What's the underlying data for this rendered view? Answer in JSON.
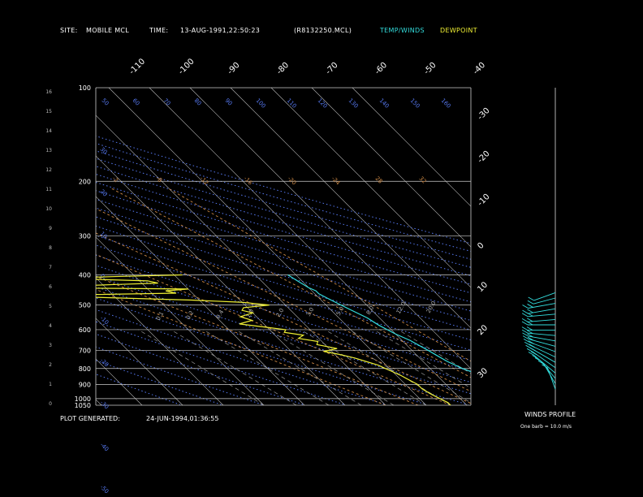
{
  "header": {
    "site_label": "SITE:",
    "site_value": "MOBILE MCL",
    "time_label": "TIME:",
    "time_value": "13-AUG-1991,22:50:23",
    "file": "(R8132250.MCL)",
    "legend_temp": "TEMP/WINDS",
    "legend_dew": "DEWPOINT"
  },
  "footer": {
    "generated_label": "PLOT GENERATED:",
    "generated_value": "24-JUN-1994,01:36:55",
    "winds_title": "WINDS PROFILE",
    "winds_note": "One barb = 10.0 m/s"
  },
  "colors": {
    "temp": "#33dddd",
    "dew": "#eeee33",
    "isotherm": "#bbbbbb",
    "dry_adiabat": "#5577ee",
    "moist_adiabat": "#cc8844",
    "mixing_ratio": "#999999",
    "frame": "#cccccc"
  },
  "chart_data": {
    "type": "line",
    "xlabel": "",
    "ylabel": "",
    "pressure_levels": [
      100,
      200,
      300,
      400,
      500,
      600,
      700,
      800,
      900,
      1000,
      1050
    ],
    "height_ticks_km": [
      0,
      1,
      2,
      3,
      4,
      5,
      6,
      7,
      8,
      9,
      10,
      11,
      12,
      13,
      14,
      15,
      16
    ],
    "temperature_ticks_top": [
      -110,
      -100,
      -90,
      -80,
      -70,
      -60,
      -50,
      -40
    ],
    "temperature_ticks_right": [
      -30,
      -20,
      -10,
      0,
      10,
      20,
      30
    ],
    "dry_adiabat_labels": [
      "50",
      "60",
      "70",
      "80",
      "90",
      "100",
      "110",
      "120",
      "130",
      "140",
      "150",
      "160"
    ],
    "dry_adiabat_left_labels": [
      "30",
      "20",
      "10",
      "0",
      "-10",
      "-20",
      "-30",
      "-40",
      "-50"
    ],
    "moist_adiabat_labels": [
      "-2",
      "-8",
      "-12",
      "-16",
      "-20",
      "-24",
      "28",
      "32"
    ],
    "mixing_ratio_labels": [
      "0.1",
      "0.2",
      "0.4",
      "1.0",
      "2.0",
      "3.0",
      "5.0",
      "8.0",
      "12.0",
      "20.0"
    ],
    "series": [
      {
        "name": "TEMP/WINDS",
        "points": [
          [
            400,
            -2
          ],
          [
            420,
            -1
          ],
          [
            440,
            0
          ],
          [
            450,
            1
          ],
          [
            460,
            1
          ],
          [
            475,
            2
          ],
          [
            490,
            3
          ],
          [
            520,
            5
          ],
          [
            550,
            7
          ],
          [
            580,
            8
          ],
          [
            620,
            10
          ],
          [
            650,
            12
          ],
          [
            700,
            14
          ],
          [
            730,
            15
          ],
          [
            760,
            16
          ],
          [
            800,
            18
          ],
          [
            830,
            20
          ],
          [
            860,
            22
          ],
          [
            900,
            24
          ],
          [
            940,
            26
          ],
          [
            980,
            28
          ],
          [
            1000,
            30
          ]
        ]
      },
      {
        "name": "DEWPOINT",
        "points": [
          [
            400,
            -28
          ],
          [
            405,
            -45
          ],
          [
            410,
            -60
          ],
          [
            418,
            -38
          ],
          [
            425,
            -36
          ],
          [
            430,
            -48
          ],
          [
            436,
            -62
          ],
          [
            440,
            -66
          ],
          [
            444,
            -30
          ],
          [
            450,
            -36
          ],
          [
            458,
            -34
          ],
          [
            466,
            -70
          ],
          [
            475,
            -48
          ],
          [
            482,
            -32
          ],
          [
            490,
            -20
          ],
          [
            500,
            -14
          ],
          [
            510,
            -21
          ],
          [
            520,
            -22
          ],
          [
            530,
            -20
          ],
          [
            545,
            -24
          ],
          [
            560,
            -22
          ],
          [
            575,
            -26
          ],
          [
            590,
            -20
          ],
          [
            600,
            -16
          ],
          [
            612,
            -17
          ],
          [
            625,
            -13
          ],
          [
            640,
            -15
          ],
          [
            655,
            -11
          ],
          [
            670,
            -12
          ],
          [
            690,
            -8
          ],
          [
            705,
            -12
          ],
          [
            720,
            -9
          ],
          [
            740,
            -6
          ],
          [
            760,
            -4
          ],
          [
            780,
            -2
          ],
          [
            800,
            -1
          ],
          [
            820,
            0
          ],
          [
            840,
            1
          ],
          [
            870,
            2
          ],
          [
            900,
            3
          ],
          [
            930,
            3
          ],
          [
            970,
            4
          ],
          [
            1000,
            5
          ],
          [
            1030,
            6
          ],
          [
            1050,
            6
          ]
        ]
      }
    ],
    "wind_barbs": [
      {
        "km": 10.5,
        "dir": 250,
        "spd": 10
      },
      {
        "km": 10.0,
        "dir": 255,
        "spd": 10
      },
      {
        "km": 9.5,
        "dir": 260,
        "spd": 20
      },
      {
        "km": 9.0,
        "dir": 260,
        "spd": 20
      },
      {
        "km": 8.5,
        "dir": 265,
        "spd": 20
      },
      {
        "km": 8.0,
        "dir": 265,
        "spd": 20
      },
      {
        "km": 7.5,
        "dir": 270,
        "spd": 20
      },
      {
        "km": 7.0,
        "dir": 270,
        "spd": 20
      },
      {
        "km": 6.5,
        "dir": 275,
        "spd": 20
      },
      {
        "km": 6.0,
        "dir": 280,
        "spd": 20
      },
      {
        "km": 5.5,
        "dir": 285,
        "spd": 20
      },
      {
        "km": 5.0,
        "dir": 290,
        "spd": 20
      },
      {
        "km": 4.5,
        "dir": 295,
        "spd": 20
      },
      {
        "km": 4.0,
        "dir": 300,
        "spd": 20
      },
      {
        "km": 3.5,
        "dir": 305,
        "spd": 20
      },
      {
        "km": 3.0,
        "dir": 310,
        "spd": 20
      },
      {
        "km": 2.5,
        "dir": 320,
        "spd": 10
      },
      {
        "km": 2.0,
        "dir": 330,
        "spd": 10
      },
      {
        "km": 1.5,
        "dir": 340,
        "spd": 10
      }
    ]
  }
}
